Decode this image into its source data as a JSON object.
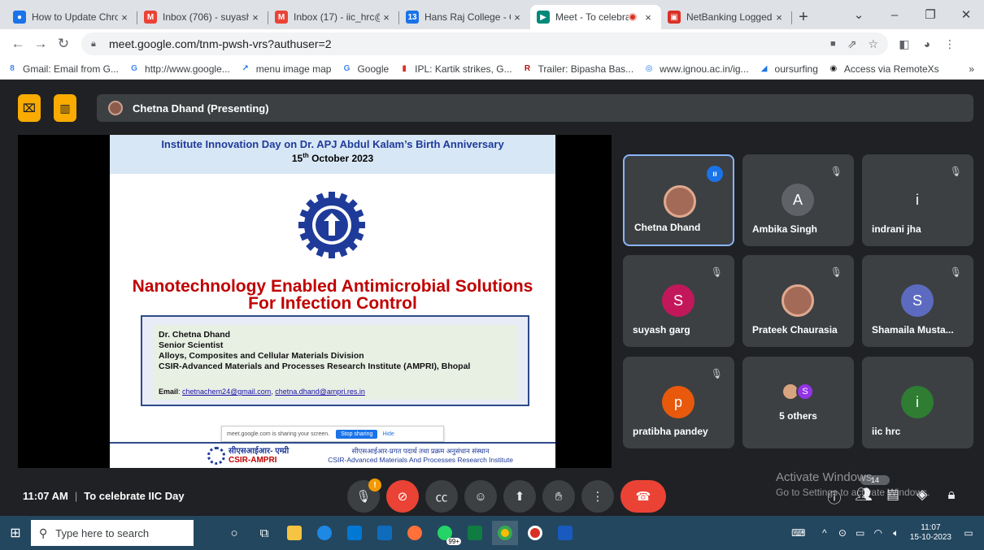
{
  "browser": {
    "tabs": [
      {
        "title": "How to Update Chro",
        "icon": "chrome-icon",
        "color": "#1a73e8",
        "letter": "●"
      },
      {
        "title": "Inbox (706) - suyashg",
        "icon": "gmail-icon",
        "color": "#ea4335",
        "letter": "M"
      },
      {
        "title": "Inbox (17) - iic_hrc@",
        "icon": "gmail-icon",
        "color": "#ea4335",
        "letter": "M"
      },
      {
        "title": "Hans Raj College - C",
        "icon": "calendar-icon",
        "color": "#1a73e8",
        "letter": "13"
      },
      {
        "title": "Meet - To celebra",
        "icon": "meet-icon",
        "color": "#00897b",
        "letter": "▶",
        "active": true
      },
      {
        "title": "NetBanking Logged",
        "icon": "bank-icon",
        "color": "#d93025",
        "letter": "▣"
      }
    ],
    "url": "meet.google.com/tnm-pwsh-vrs?authuser=2",
    "bookmarks": [
      {
        "label": "Gmail: Email from G...",
        "icon": "8",
        "color": "#4285f4"
      },
      {
        "label": "http://www.google...",
        "icon": "G",
        "color": "#4285f4"
      },
      {
        "label": "menu image map",
        "icon": "↗",
        "color": "#1a73e8"
      },
      {
        "label": "Google",
        "icon": "G",
        "color": "#4285f4"
      },
      {
        "label": "IPL: Kartik strikes, G...",
        "icon": "▮",
        "color": "#d93025"
      },
      {
        "label": "Trailer: Bipasha Bas...",
        "icon": "R",
        "color": "#b31412"
      },
      {
        "label": "www.ignou.ac.in/ig...",
        "icon": "◎",
        "color": "#1a73e8"
      },
      {
        "label": "oursurfing",
        "icon": "◢",
        "color": "#1a73e8"
      },
      {
        "label": "Access via RemoteXs",
        "icon": "◉",
        "color": "#202124"
      }
    ],
    "bookmarks_more": "»"
  },
  "meet": {
    "presenting_label": "Chetna Dhand (Presenting)",
    "slide": {
      "header_line1": "Institute Innovation Day on Dr. APJ Abdul Kalam’s Birth Anniversary",
      "header_date_day": "15",
      "header_date_sup": "th",
      "header_date_rest": " October 2023",
      "title_line1": "Nanotechnology Enabled Antimicrobial Solutions",
      "title_line2": "For Infection Control",
      "author": "Dr. Chetna Dhand",
      "position": "Senior Scientist",
      "division": "Alloys, Composites and Cellular Materials Division",
      "institute": "CSIR-Advanced Materials and Processes Research Institute (AMPRI), Bhopal",
      "email_label": "Email",
      "email_1": "chetnachem24@gmail.com",
      "email_sep": ", ",
      "email_2": "chetna.dhand@ampri.res.in",
      "share_msg": "meet.google.com is sharing your screen.",
      "share_stop": "Stop sharing",
      "share_hide": "Hide",
      "footer_logo_hindi": "सीएसआईआर- एम्प्री",
      "footer_logo_en": "CSIR-AMPRI",
      "footer_right_hindi": "सीएसआईआर-प्रगत पदार्थ तथा प्रक्रम अनुसंधान संस्थान",
      "footer_right_en": "CSIR-Advanced Materials And Processes Research Institute"
    },
    "participants": [
      {
        "name": "Chetna Dhand",
        "type": "photo",
        "speaking": true
      },
      {
        "name": "Ambika Singh",
        "initial": "A",
        "color": "#5f6368",
        "muted": true
      },
      {
        "name": "indrani jha",
        "initial": "i",
        "color": "#3c4043",
        "muted": true
      },
      {
        "name": "suyash garg",
        "initial": "S",
        "color": "#c2185b",
        "muted": true
      },
      {
        "name": "Prateek Chaurasia",
        "type": "photo",
        "muted": true
      },
      {
        "name": "Shamaila Musta...",
        "initial": "S",
        "color": "#5c6bc0",
        "muted": true
      },
      {
        "name": "pratibha pandey",
        "initial": "p",
        "color": "#e8590c",
        "muted": true
      },
      {
        "others_label": "5 others",
        "others_initial": "S"
      },
      {
        "name": "iic hrc",
        "initial": "i",
        "color": "#2e7d32"
      }
    ],
    "time": "11:07 AM",
    "meeting_title": "To celebrate IIC Day",
    "people_count": "14",
    "watermark_line1": "Activate Windows",
    "watermark_line2": "Go to Settings to activate Windows."
  },
  "taskbar": {
    "search_placeholder": "Type here to search",
    "clock_time": "11:07",
    "clock_date": "15-10-2023",
    "badge": "99+"
  }
}
